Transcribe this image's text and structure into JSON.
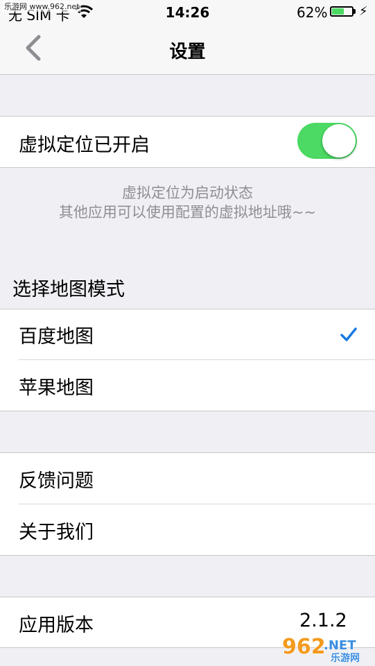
{
  "watermark_top": "乐游网 www.962.net",
  "status_bar": {
    "carrier": "无 SIM 卡",
    "time": "14:26",
    "battery_percent": "62%",
    "battery_level": 0.62
  },
  "navbar": {
    "title": "设置",
    "back_icon": "chevron-left-icon"
  },
  "virtual_location": {
    "label": "虚拟定位已开启",
    "enabled": true,
    "note_line1": "虚拟定位为启动状态",
    "note_line2": "其他应用可以使用配置的虚拟地址哦~~"
  },
  "map_mode": {
    "header": "选择地图模式",
    "options": [
      {
        "label": "百度地图",
        "selected": true
      },
      {
        "label": "苹果地图",
        "selected": false
      }
    ]
  },
  "misc": {
    "feedback": "反馈问题",
    "about": "关于我们"
  },
  "version": {
    "label": "应用版本",
    "value": "2.1.2"
  },
  "watermark_bottom": {
    "brand": "962",
    "suffix": ".NET",
    "caption": "乐游网"
  },
  "colors": {
    "accent": "#4cd964",
    "check": "#1a7ae0",
    "note": "#8e8e93"
  }
}
